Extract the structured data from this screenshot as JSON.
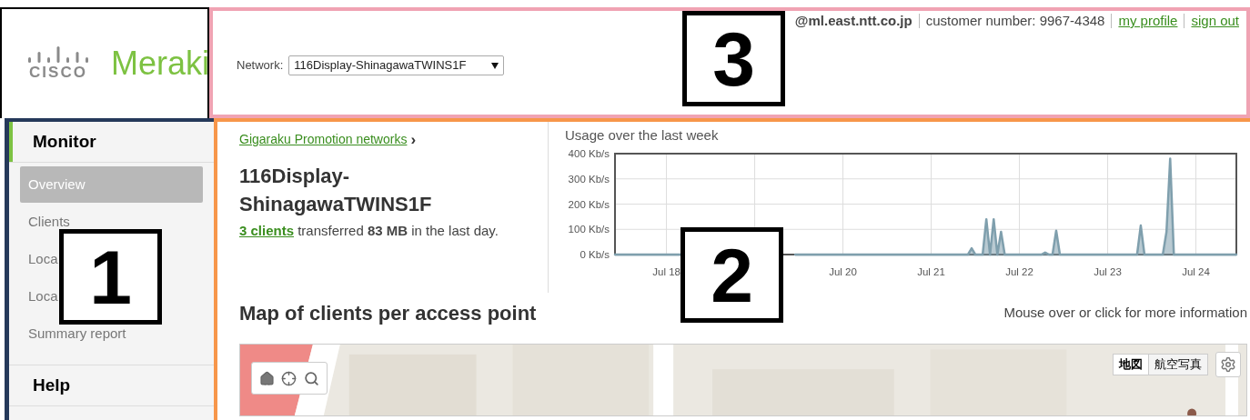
{
  "logo": {
    "wordmark": "CISCO",
    "product": "Meraki"
  },
  "header": {
    "network_label": "Network:",
    "network_value": "116Display-ShinagawaTWINS1F",
    "email": "@ml.east.ntt.co.jp",
    "customer_number": "customer number: 9967-4348",
    "links": [
      "my profile",
      "sign out"
    ]
  },
  "sidebar": {
    "sections": [
      {
        "title": "Monitor",
        "active": true,
        "items": [
          {
            "label": "Overview",
            "selected": true
          },
          {
            "label": "Clients",
            "selected": false
          },
          {
            "label": "Loca",
            "selected": false
          },
          {
            "label": "Loca",
            "selected": false
          },
          {
            "label": "Summary report",
            "selected": false
          }
        ]
      },
      {
        "title": "Help",
        "active": false
      }
    ]
  },
  "breadcrumb": {
    "label": "Gigaraku Promotion networks",
    "separator": "›"
  },
  "network_title": "116Display-ShinagawaTWINS1F",
  "summary": {
    "link": "3 clients",
    "rest": "transferred **83 MB** in the last day."
  },
  "usage_chart": {
    "title": "Usage over the last week",
    "chart_data": {
      "type": "area",
      "categories": [
        null,
        null,
        null,
        null,
        null,
        null,
        null,
        null,
        null,
        null,
        null,
        null,
        null,
        null,
        "Jul 18",
        null,
        null,
        null,
        null,
        null,
        null,
        null,
        null,
        null,
        null,
        null,
        null,
        null,
        null,
        null,
        null,
        null,
        null,
        null,
        null,
        null,
        null,
        null,
        null,
        null,
        null,
        null,
        null,
        null,
        null,
        null,
        null,
        null,
        null,
        null,
        null,
        null,
        null,
        null,
        null,
        null,
        null,
        null,
        null,
        null,
        null,
        null,
        "Jul 20",
        null,
        null,
        null,
        null,
        null,
        null,
        null,
        null,
        null,
        null,
        null,
        null,
        null,
        null,
        null,
        null,
        null,
        null,
        null,
        null,
        null,
        null,
        null,
        "Jul 21",
        null,
        null,
        null,
        null,
        null,
        null,
        null,
        null,
        null,
        null,
        null,
        null,
        null,
        null,
        null,
        null,
        null,
        null,
        null,
        null,
        null,
        null,
        null,
        "Jul 22",
        null,
        null,
        null,
        null,
        null,
        null,
        null,
        null,
        null,
        null,
        null,
        null,
        null,
        null,
        null,
        null,
        null,
        null,
        null,
        null,
        null,
        null,
        null,
        "Jul 23",
        null,
        null,
        null,
        null,
        null,
        null,
        null,
        null,
        null,
        null,
        null,
        null,
        null,
        null,
        null,
        null,
        null,
        null,
        null,
        null,
        null,
        null,
        null,
        "Jul 24",
        null,
        null,
        null,
        null,
        null,
        null,
        null,
        null,
        null,
        null,
        null
      ],
      "grid": true,
      "series": [
        {
          "color": "#7f9fad",
          "values": [
            0,
            0,
            0,
            0,
            0,
            0,
            0,
            0,
            0,
            0,
            0,
            0,
            0,
            0,
            0,
            0,
            0,
            0,
            0,
            null,
            null,
            null,
            null,
            null,
            null,
            null,
            null,
            null,
            null,
            null,
            null,
            null,
            null,
            null,
            null,
            null,
            null,
            null,
            null,
            null,
            null,
            null,
            null,
            null,
            null,
            null,
            null,
            null,
            null,
            0,
            0,
            0,
            0,
            0,
            0,
            0,
            0,
            0,
            0,
            0,
            0,
            0,
            0,
            0,
            0,
            0,
            0,
            0,
            0,
            0,
            0,
            0,
            0,
            0,
            0,
            0,
            0,
            0,
            0,
            0,
            0,
            0,
            0,
            0,
            0,
            0,
            0,
            0,
            0,
            0,
            0,
            0,
            0,
            0,
            0,
            0,
            0,
            25,
            0,
            0,
            0,
            140,
            0,
            140,
            0,
            90,
            0,
            0,
            0,
            0,
            0,
            0,
            0,
            0,
            0,
            0,
            0,
            8,
            0,
            0,
            95,
            0,
            0,
            0,
            0,
            0,
            0,
            0,
            0,
            0,
            0,
            0,
            0,
            0,
            0,
            0,
            0,
            0,
            0,
            0,
            0,
            0,
            0,
            115,
            0,
            0,
            0,
            0,
            0,
            0,
            90,
            380,
            0,
            0,
            0,
            0,
            0,
            0,
            0,
            0,
            0,
            0,
            0,
            0,
            0,
            0,
            0,
            0,
            0,
            0
          ]
        }
      ],
      "ylim": [
        0,
        400
      ],
      "yticks": [
        {
          "value": 0,
          "label": "0 Kb/s"
        },
        {
          "value": 100,
          "label": "100 Kb/s"
        },
        {
          "value": 200,
          "label": "200 Kb/s"
        },
        {
          "value": 300,
          "label": "300 Kb/s"
        },
        {
          "value": 400,
          "label": "400 Kb/s"
        }
      ]
    }
  },
  "map_section": {
    "title": "Map of clients per access point",
    "hint": "Mouse over or click for more information",
    "map_types": [
      {
        "label": "地図",
        "selected": true
      },
      {
        "label": "航空写真",
        "selected": false
      }
    ]
  },
  "annotations": [
    {
      "label": "1"
    },
    {
      "label": "2"
    },
    {
      "label": "3"
    }
  ]
}
